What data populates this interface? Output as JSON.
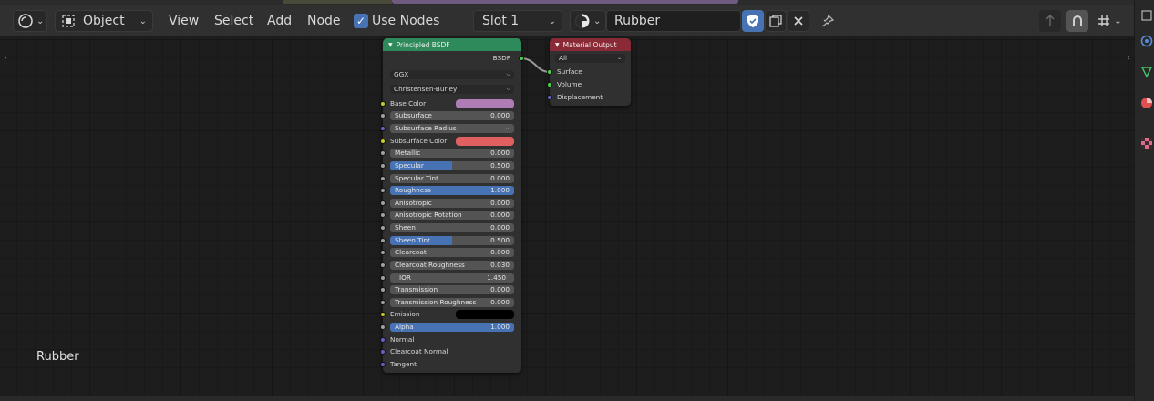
{
  "header": {
    "mode_label": "Object",
    "menus": [
      "View",
      "Select",
      "Add",
      "Node"
    ],
    "use_nodes_label": "Use Nodes",
    "slot_label": "Slot 1",
    "material_name": "Rubber"
  },
  "canvas": {
    "material_label": "Rubber"
  },
  "nodes": {
    "bsdf": {
      "title": "Principled BSDF",
      "output_label": "BSDF",
      "distribution": "GGX",
      "subsurface_method": "Christensen-Burley",
      "base_color_label": "Base Color",
      "base_color": "#b07cb6",
      "subsurface_label": "Subsurface",
      "subsurface_value": "0.000",
      "subsurface_radius_label": "Subsurface Radius",
      "subsurface_color_label": "Subsurface Color",
      "subsurface_color": "#e06060",
      "metallic_label": "Metallic",
      "metallic_value": "0.000",
      "specular_label": "Specular",
      "specular_value": "0.500",
      "specular_tint_label": "Specular Tint",
      "specular_tint_value": "0.000",
      "roughness_label": "Roughness",
      "roughness_value": "1.000",
      "anisotropic_label": "Anisotropic",
      "anisotropic_value": "0.000",
      "anisotropic_rotation_label": "Anisotropic Rotation",
      "anisotropic_rotation_value": "0.000",
      "sheen_label": "Sheen",
      "sheen_value": "0.000",
      "sheen_tint_label": "Sheen Tint",
      "sheen_tint_value": "0.500",
      "clearcoat_label": "Clearcoat",
      "clearcoat_value": "0.000",
      "clearcoat_roughness_label": "Clearcoat Roughness",
      "clearcoat_roughness_value": "0.030",
      "ior_label": "IOR",
      "ior_value": "1.450",
      "transmission_label": "Transmission",
      "transmission_value": "0.000",
      "transmission_roughness_label": "Transmission Roughness",
      "transmission_roughness_value": "0.000",
      "emission_label": "Emission",
      "emission_color": "#000000",
      "alpha_label": "Alpha",
      "alpha_value": "1.000",
      "normal_label": "Normal",
      "clearcoat_normal_label": "Clearcoat Normal",
      "tangent_label": "Tangent",
      "header_color": "#2e8a5a"
    },
    "output": {
      "title": "Material Output",
      "target": "All",
      "surface_label": "Surface",
      "volume_label": "Volume",
      "displacement_label": "Displacement",
      "header_color": "#8a2a36"
    }
  },
  "icons": {
    "editor_type": "node-editor-icon",
    "mode": "object-mode-icon",
    "shading": "material-sphere-icon",
    "fake_user": "shield-check-icon",
    "duplicate": "duplicate-icon",
    "unlink": "close-icon",
    "pin": "pin-icon"
  }
}
